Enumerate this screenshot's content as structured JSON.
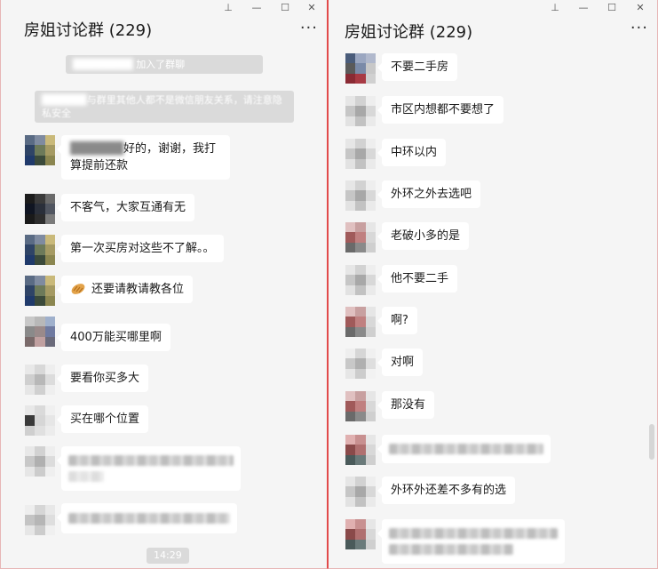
{
  "left": {
    "title": "房姐讨论群 (229)",
    "more": "···",
    "controls": {
      "pin": "⊥",
      "minimize": "—",
      "maximize": "☐",
      "close": "✕"
    },
    "system_join": {
      "name_blur": "████████",
      "text": "加入了群聊"
    },
    "system_warning": {
      "blur_prefix": "██████",
      "text": "与群里其他人都不是微信朋友关系，请注意隐私安全"
    },
    "messages": [
      {
        "blur_prefix": "██████",
        "text": "好的，谢谢，我打算提前还款"
      },
      {
        "text": "不客气，大家互通有无"
      },
      {
        "text": "第一次买房对这些不了解。。"
      },
      {
        "emoji": "bread-emoji",
        "text": "还要请教请教各位"
      },
      {
        "text": "400万能买哪里啊"
      },
      {
        "text": "要看你买多大"
      },
      {
        "text": "买在哪个位置"
      },
      {
        "blurred": "████████████████████"
      },
      {
        "blurred": "████████████████████"
      }
    ],
    "time": "14:29"
  },
  "right": {
    "title": "房姐讨论群 (229)",
    "more": "···",
    "controls": {
      "pin": "⊥",
      "minimize": "—",
      "maximize": "☐",
      "close": "✕"
    },
    "messages": [
      {
        "text": "不要二手房"
      },
      {
        "text": "市区内想都不要想了"
      },
      {
        "text": "中环以内"
      },
      {
        "text": "外环之外去选吧"
      },
      {
        "text": "老破小多的是"
      },
      {
        "text": "他不要二手"
      },
      {
        "text": "啊?"
      },
      {
        "text": "对啊"
      },
      {
        "text": "那没有"
      },
      {
        "blurred": "████████████████████"
      },
      {
        "text": "外环外还差不多有的选"
      },
      {
        "blurred": "████████████████████"
      }
    ]
  },
  "colors": {
    "window_border": "#e24a4a",
    "chat_bg": "#f5f5f5",
    "bubble_bg": "#ffffff",
    "system_pill_bg": "#dadada"
  }
}
